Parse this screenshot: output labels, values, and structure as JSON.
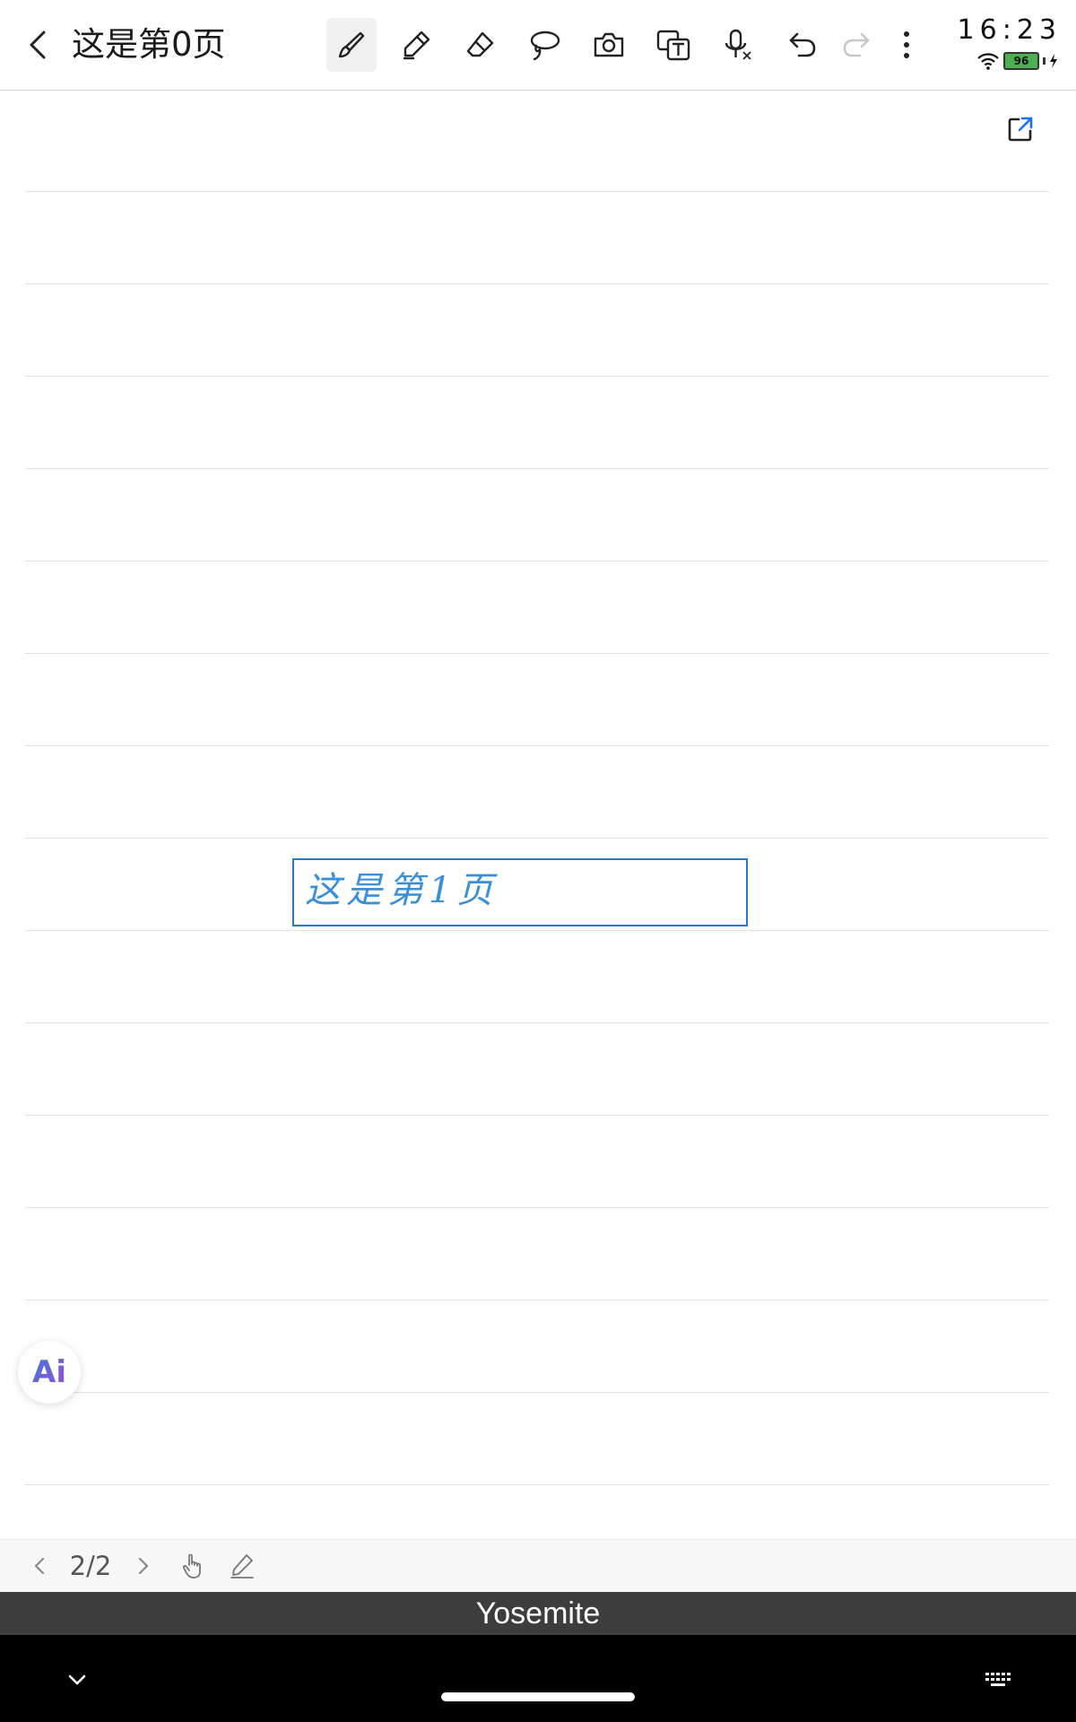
{
  "header": {
    "title": "这是第0页",
    "tools": [
      "brush-icon",
      "pencil-icon",
      "eraser-icon",
      "lasso-icon",
      "camera-icon",
      "text-recognition-icon",
      "voice-input-icon",
      "undo-icon",
      "redo-icon",
      "more-icon"
    ]
  },
  "status": {
    "time": "16:23",
    "battery": "96"
  },
  "canvas": {
    "handwritten_text": "这是第1页"
  },
  "ai_button": {
    "label": "Ai"
  },
  "pager": {
    "page_count": "2/2"
  },
  "keyboard": {
    "suggestion": "Yosemite"
  },
  "colors": {
    "accent": "#2a78c8",
    "ink": "#3a8fd9",
    "rule": "#e3e3e3"
  }
}
